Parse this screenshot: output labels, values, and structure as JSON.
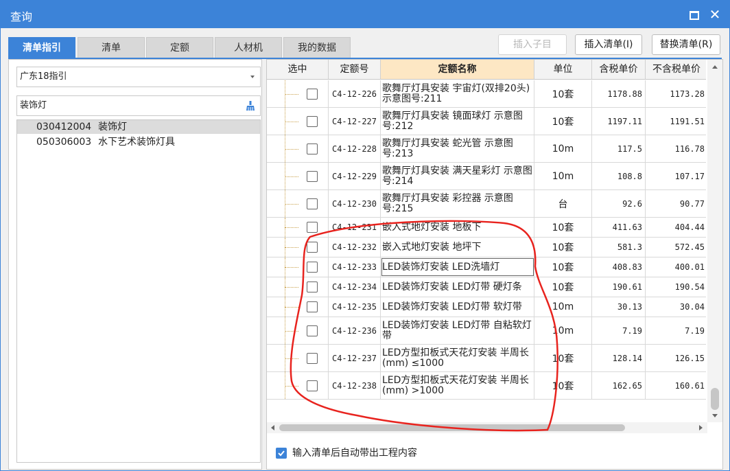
{
  "window": {
    "title": "查询"
  },
  "tabs": [
    {
      "label": "清单指引",
      "active": true
    },
    {
      "label": "清单",
      "active": false
    },
    {
      "label": "定额",
      "active": false
    },
    {
      "label": "人材机",
      "active": false
    },
    {
      "label": "我的数据",
      "active": false
    }
  ],
  "toolbar": {
    "insert_child": "插入子目",
    "insert_list": "插入清单(I)",
    "replace_list": "替换清单(R)"
  },
  "left": {
    "select_value": "广东18指引",
    "search_value": "装饰灯",
    "items": [
      {
        "code": "030412004",
        "name": "装饰灯",
        "selected": true
      },
      {
        "code": "050306003",
        "name": "水下艺术装饰灯具",
        "selected": false
      }
    ]
  },
  "table": {
    "headers": [
      "选中",
      "定额号",
      "定额名称",
      "单位",
      "含税单价",
      "不含税单价"
    ],
    "rows": [
      {
        "code": "C4-12-226",
        "name": "歌舞厅灯具安装 宇宙灯(双排20头) 示意图号:211",
        "unit": "10套",
        "tax": "1178.88",
        "notax": "1173.28"
      },
      {
        "code": "C4-12-227",
        "name": "歌舞厅灯具安装 镜面球灯 示意图号:212",
        "unit": "10套",
        "tax": "1197.11",
        "notax": "1191.51"
      },
      {
        "code": "C4-12-228",
        "name": "歌舞厅灯具安装 蛇光管 示意图号:213",
        "unit": "10m",
        "tax": "117.5",
        "notax": "116.78"
      },
      {
        "code": "C4-12-229",
        "name": "歌舞厅灯具安装 满天星彩灯 示意图号:214",
        "unit": "10m",
        "tax": "108.8",
        "notax": "107.17"
      },
      {
        "code": "C4-12-230",
        "name": "歌舞厅灯具安装 彩控器 示意图号:215",
        "unit": "台",
        "tax": "92.6",
        "notax": "90.77"
      },
      {
        "code": "C4-12-231",
        "name": "嵌入式地灯安装 地板下",
        "unit": "10套",
        "tax": "411.63",
        "notax": "404.44"
      },
      {
        "code": "C4-12-232",
        "name": "嵌入式地灯安装 地坪下",
        "unit": "10套",
        "tax": "581.3",
        "notax": "572.45"
      },
      {
        "code": "C4-12-233",
        "name": "LED装饰灯安装 LED洗墙灯",
        "unit": "10套",
        "tax": "408.83",
        "notax": "400.01"
      },
      {
        "code": "C4-12-234",
        "name": "LED装饰灯安装 LED灯带 硬灯条",
        "unit": "10套",
        "tax": "190.61",
        "notax": "190.54"
      },
      {
        "code": "C4-12-235",
        "name": "LED装饰灯安装 LED灯带 软灯带",
        "unit": "10m",
        "tax": "30.13",
        "notax": "30.04"
      },
      {
        "code": "C4-12-236",
        "name": "LED装饰灯安装 LED灯带 自粘软灯带",
        "unit": "10m",
        "tax": "7.19",
        "notax": "7.19"
      },
      {
        "code": "C4-12-237",
        "name": "LED方型扣板式天花灯安装 半周长(mm) ≤1000",
        "unit": "10套",
        "tax": "128.14",
        "notax": "126.15"
      },
      {
        "code": "C4-12-238",
        "name": "LED方型扣板式天花灯安装 半周长(mm) >1000",
        "unit": "10套",
        "tax": "162.65",
        "notax": "160.61"
      }
    ]
  },
  "footer": {
    "auto_label": "输入清单后自动带出工程内容",
    "checked": true
  },
  "colors": {
    "accent": "#3c83d8",
    "header_highlight": "#fde7c4",
    "annotation": "#e8231e"
  }
}
